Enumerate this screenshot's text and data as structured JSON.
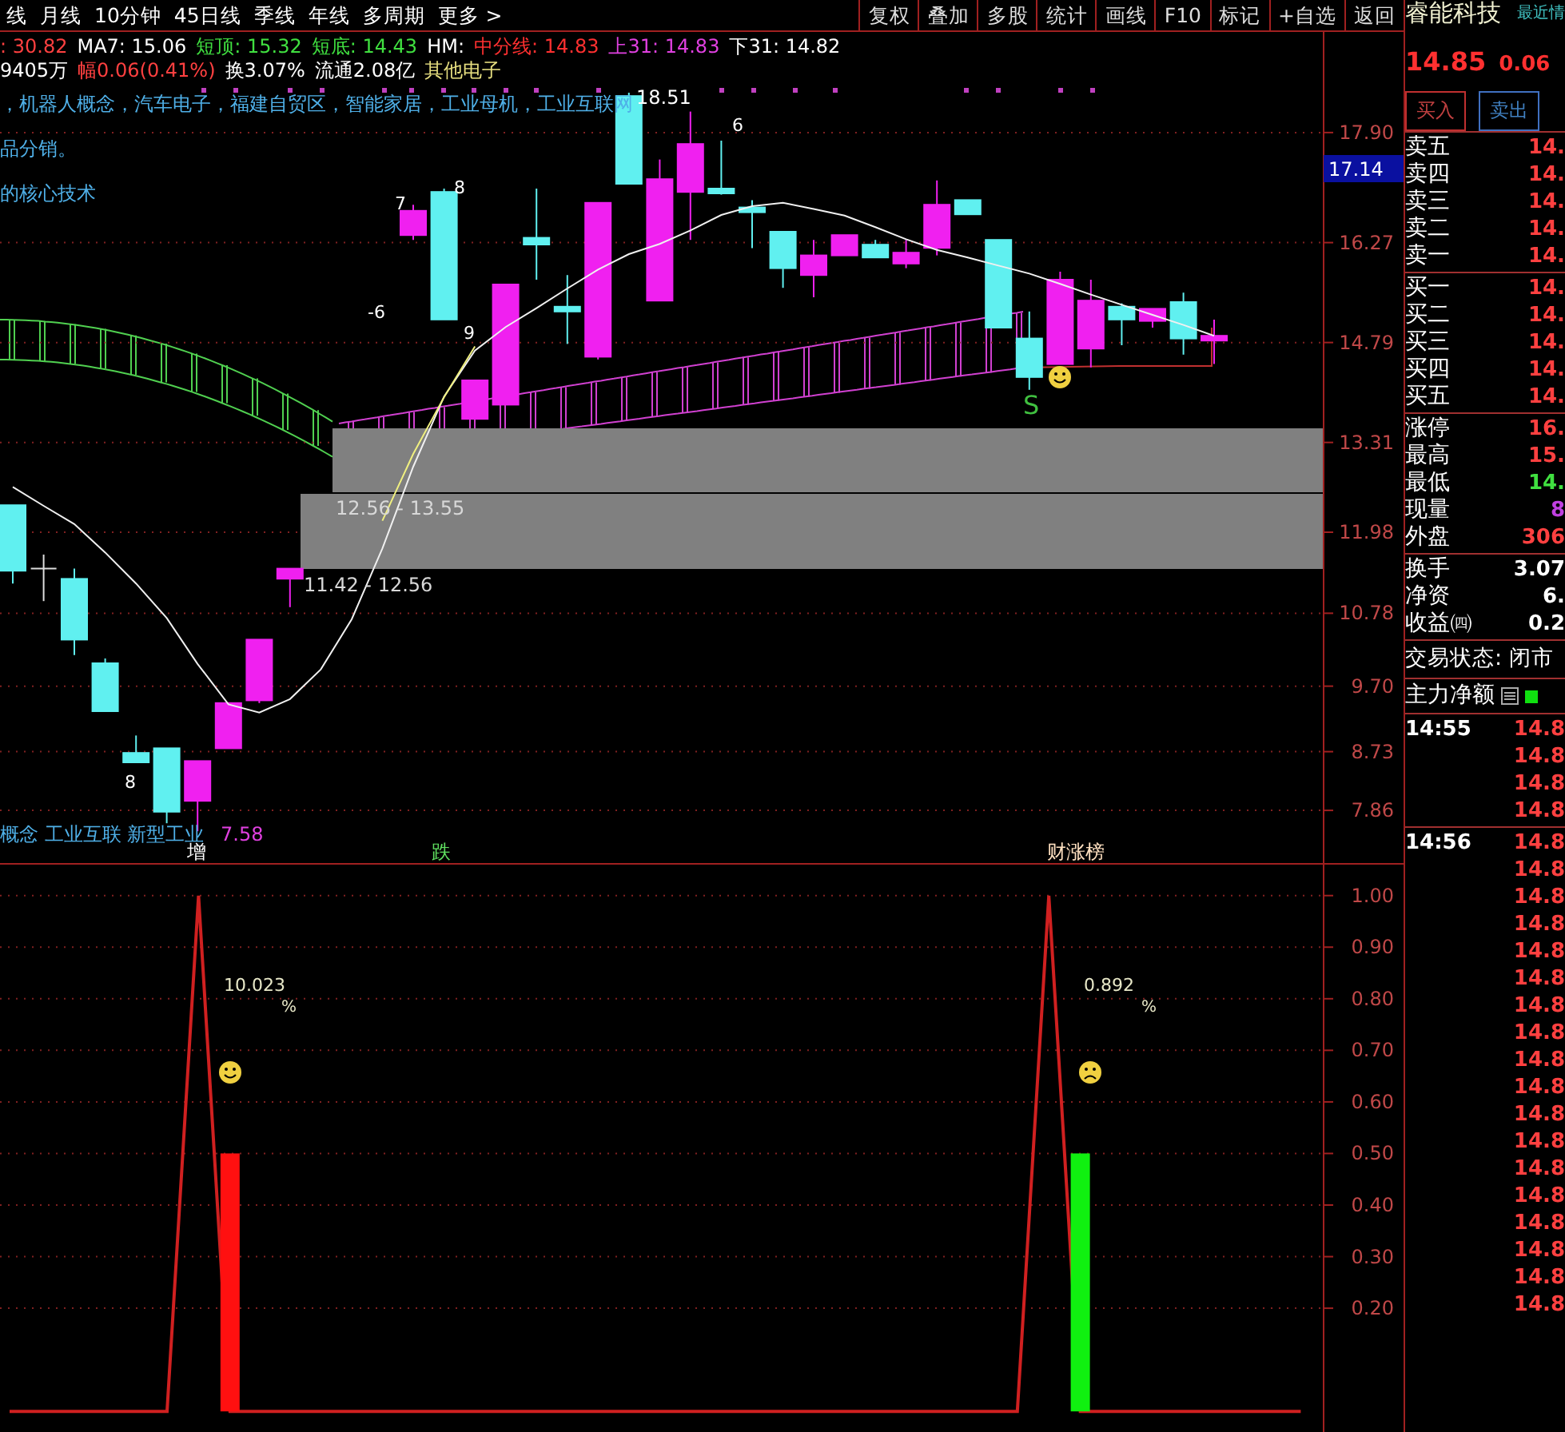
{
  "toolbar": {
    "periods": [
      "线",
      "月线",
      "10分钟",
      "45日线",
      "季线",
      "年线",
      "多周期",
      "更多 >"
    ],
    "actions": [
      "复权",
      "叠加",
      "多股",
      "统计",
      "画线",
      "F10",
      "标记",
      "+自选",
      "返回"
    ]
  },
  "readout_lines": [
    {
      "segments": [
        {
          "text": ": 30.82",
          "color": "#ff4040"
        },
        {
          "text": "MA7: 15.06",
          "color": "#ffffff"
        },
        {
          "text": "短顶: 15.32",
          "color": "#40e040"
        },
        {
          "text": "短底: 14.43",
          "color": "#40e040"
        },
        {
          "text": "HM:",
          "color": "#ffffff"
        },
        {
          "text": "中分线: 14.83",
          "color": "#ff3030"
        },
        {
          "text": "上31: 14.83",
          "color": "#e040e0"
        },
        {
          "text": "下31: 14.82",
          "color": "#ffffff"
        }
      ]
    },
    {
      "segments": [
        {
          "text": "9405万",
          "color": "#ffffff"
        },
        {
          "text": "幅0.06(0.41%)",
          "color": "#ff4040"
        },
        {
          "text": "换3.07%",
          "color": "#ffffff"
        },
        {
          "text": "流通2.08亿",
          "color": "#ffffff"
        },
        {
          "text": "其他电子",
          "color": "#e8e080"
        }
      ]
    }
  ],
  "concept_lines": [
    "，机器人概念，汽车电子，福建自贸区，智能家居，工业母机，工业互联网",
    "品分销。",
    "的核心技术"
  ],
  "chart_labels": [
    {
      "text": "18.51",
      "color": "#ffffff"
    },
    {
      "text": "6",
      "color": "#ffffff"
    },
    {
      "text": "7",
      "color": "#ffffff"
    },
    {
      "text": "8",
      "color": "#ffffff"
    },
    {
      "text": "-6",
      "color": "#ffffff"
    },
    {
      "text": "9",
      "color": "#ffffff"
    },
    {
      "text": "12.56 - 13.55",
      "color": "#d8d8d8"
    },
    {
      "text": "11.42 - 12.56",
      "color": "#d8d8d8"
    },
    {
      "text": "S",
      "color": "#40c040"
    },
    {
      "text": "8",
      "color": "#ffffff"
    }
  ],
  "bottom_tags": [
    {
      "text": "概念 工业互联 新型工业",
      "color": "#4fb0e8"
    },
    {
      "text": "7.58",
      "color": "#e040e0"
    },
    {
      "text": "增",
      "color": "#ffffff"
    },
    {
      "text": "跌",
      "color": "#60e060"
    },
    {
      "text": "财涨榜",
      "color": "#ffe0c0"
    }
  ],
  "main_chart": {
    "chart_data": {
      "type": "candlestick",
      "grid": true,
      "ylim": [
        7.08,
        19.39
      ],
      "ohlc": [
        [
          12.38,
          12.38,
          11.22,
          11.41
        ],
        [
          11.44,
          11.65,
          10.96,
          11.44
        ],
        [
          11.29,
          11.44,
          10.16,
          10.39
        ],
        [
          10.04,
          10.11,
          9.33,
          9.33
        ],
        [
          8.71,
          8.97,
          8.57,
          8.57
        ],
        [
          8.78,
          8.78,
          7.67,
          7.84
        ],
        [
          8.0,
          8.59,
          7.55,
          8.59
        ],
        [
          8.78,
          9.45,
          8.78,
          9.45
        ],
        [
          9.49,
          10.39,
          9.45,
          10.39
        ],
        [
          11.29,
          11.44,
          10.87,
          11.44
        ],
        null,
        null,
        null,
        [
          16.38,
          16.83,
          16.31,
          16.74
        ],
        [
          17.02,
          17.07,
          15.13,
          15.13
        ],
        [
          13.66,
          14.23,
          13.66,
          14.23
        ],
        [
          13.87,
          15.65,
          13.87,
          15.65
        ],
        [
          16.34,
          17.07,
          15.72,
          16.24
        ],
        [
          15.32,
          15.79,
          14.77,
          15.25
        ],
        [
          14.58,
          16.86,
          14.54,
          16.86
        ],
        [
          18.44,
          18.49,
          17.14,
          17.14
        ],
        [
          15.41,
          17.5,
          15.41,
          17.21
        ],
        [
          17.02,
          18.21,
          16.31,
          17.73
        ],
        [
          17.07,
          17.78,
          16.98,
          17.0
        ],
        [
          16.79,
          16.9,
          16.19,
          16.72
        ],
        [
          16.43,
          16.43,
          15.6,
          15.89
        ],
        [
          15.79,
          16.31,
          15.46,
          16.08
        ],
        [
          16.08,
          16.38,
          16.08,
          16.38
        ],
        [
          16.24,
          16.31,
          16.05,
          16.05
        ],
        [
          15.96,
          16.31,
          15.89,
          16.12
        ],
        [
          16.19,
          17.19,
          16.08,
          16.83
        ],
        [
          16.9,
          16.9,
          16.69,
          16.69
        ],
        [
          16.31,
          16.31,
          15.01,
          15.01
        ],
        [
          14.85,
          15.25,
          14.09,
          14.28
        ],
        [
          14.47,
          15.84,
          14.47,
          15.72
        ],
        [
          14.7,
          15.72,
          14.42,
          15.41
        ],
        [
          15.32,
          15.37,
          14.75,
          15.13
        ],
        [
          15.11,
          15.29,
          15.01,
          15.29
        ],
        [
          15.39,
          15.53,
          14.61,
          14.85
        ],
        [
          14.82,
          15.13,
          14.47,
          14.89
        ]
      ],
      "yticks": [
        {
          "value": 17.9,
          "label": "17.90"
        },
        {
          "value": 16.27,
          "label": "16.27"
        },
        {
          "value": 14.79,
          "label": "14.79"
        },
        {
          "value": 13.31,
          "label": "13.31"
        },
        {
          "value": 11.98,
          "label": "11.98"
        },
        {
          "value": 10.78,
          "label": "10.78"
        },
        {
          "value": 9.7,
          "label": "9.70"
        },
        {
          "value": 8.73,
          "label": "8.73"
        },
        {
          "value": 7.86,
          "label": "7.86"
        }
      ],
      "series": [
        {
          "type": "line",
          "color": "#f0f0f0",
          "values": [
            12.65,
            12.37,
            12.1,
            11.68,
            11.22,
            10.71,
            10.03,
            9.43,
            9.31,
            9.51,
            9.95,
            10.69,
            11.74,
            12.95,
            13.99,
            14.67,
            15.02,
            15.3,
            15.59,
            15.87,
            16.1,
            16.25,
            16.45,
            16.68,
            16.81,
            16.86,
            16.77,
            16.67,
            16.5,
            16.32,
            16.16,
            16.05,
            15.93,
            15.81,
            15.66,
            15.5,
            15.35,
            15.2,
            15.05,
            14.89
          ]
        },
        {
          "type": "line",
          "color": "#f0f080",
          "values": [
            null,
            null,
            null,
            null,
            null,
            null,
            null,
            null,
            null,
            null,
            null,
            null,
            12.15,
            13.14,
            13.98,
            14.73,
            null,
            null,
            null,
            null,
            null,
            null,
            null,
            null,
            null,
            null,
            null,
            null,
            null,
            null,
            null,
            null,
            null,
            null,
            null,
            null,
            null,
            null,
            null,
            null
          ]
        }
      ]
    },
    "current": "17.14"
  },
  "indicator": {
    "chart_data": {
      "type": "line",
      "grid": true,
      "ylim": [
        -0.04,
        1.06
      ],
      "yticks": [
        {
          "value": 1,
          "label": "1.00"
        },
        {
          "value": 0.9,
          "label": "0.90"
        },
        {
          "value": 0.8,
          "label": "0.80"
        },
        {
          "value": 0.7,
          "label": "0.70"
        },
        {
          "value": 0.6,
          "label": "0.60"
        },
        {
          "value": 0.5,
          "label": "0.50"
        },
        {
          "value": 0.4,
          "label": "0.40"
        },
        {
          "value": 0.3,
          "label": "0.30"
        },
        {
          "value": 0.2,
          "label": "0.20"
        }
      ],
      "series": [
        {
          "color": "#d02020",
          "values": [
            0,
            0,
            0,
            0,
            0,
            0,
            1,
            0,
            0,
            0,
            0,
            0,
            0,
            0,
            0,
            0,
            0,
            0,
            0,
            0,
            0,
            0,
            0,
            0,
            0,
            0,
            0,
            0,
            0,
            0,
            0,
            0,
            0,
            1,
            0,
            0,
            0,
            0,
            0,
            0,
            0,
            0
          ]
        },
        {
          "type": "bar",
          "color": "#ff1010",
          "values": [
            null,
            null,
            null,
            null,
            null,
            null,
            null,
            0.5,
            null,
            null,
            null,
            null,
            null,
            null,
            null,
            null,
            null,
            null,
            null,
            null,
            null,
            null,
            null,
            null,
            null,
            null,
            null,
            null,
            null,
            null,
            null,
            null,
            null,
            null,
            null,
            null,
            null,
            null,
            null,
            null,
            null,
            null
          ]
        },
        {
          "type": "bar",
          "color": "#10f010",
          "values": [
            null,
            null,
            null,
            null,
            null,
            null,
            null,
            null,
            null,
            null,
            null,
            null,
            null,
            null,
            null,
            null,
            null,
            null,
            null,
            null,
            null,
            null,
            null,
            null,
            null,
            null,
            null,
            null,
            null,
            null,
            null,
            null,
            null,
            null,
            0.5,
            null,
            null,
            null,
            null,
            null,
            null,
            null
          ]
        }
      ]
    },
    "labels": [
      {
        "value": "10.023",
        "unit": "%",
        "kind": "happy"
      },
      {
        "value": "0.892",
        "unit": "%",
        "kind": "sad"
      }
    ]
  },
  "quote": {
    "name": "睿能科技",
    "tab": "最近情",
    "price": "14.85",
    "change": "0.06",
    "buy": "买入",
    "sell": "卖出"
  },
  "book": [
    [
      {
        "label": "卖五",
        "value": "14.",
        "color": "#ff4040"
      },
      {
        "label": "卖四",
        "value": "14.",
        "color": "#ff4040"
      },
      {
        "label": "卖三",
        "value": "14.",
        "color": "#ff4040"
      },
      {
        "label": "卖二",
        "value": "14.",
        "color": "#ff4040"
      },
      {
        "label": "卖一",
        "value": "14.",
        "color": "#ff4040"
      }
    ],
    [
      {
        "label": "买一",
        "value": "14.",
        "color": "#ff4040"
      },
      {
        "label": "买二",
        "value": "14.",
        "color": "#ff4040"
      },
      {
        "label": "买三",
        "value": "14.",
        "color": "#ff4040"
      },
      {
        "label": "买四",
        "value": "14.",
        "color": "#ff4040"
      },
      {
        "label": "买五",
        "value": "14.",
        "color": "#ff4040"
      }
    ],
    [
      {
        "label": "涨停",
        "value": "16.",
        "color": "#ff4040"
      },
      {
        "label": "最高",
        "value": "15.",
        "color": "#ff4040"
      },
      {
        "label": "最低",
        "value": "14.",
        "color": "#40e040"
      },
      {
        "label": "现量",
        "value": "8",
        "color": "#c040e0"
      },
      {
        "label": "外盘",
        "value": "306",
        "color": "#ff4040"
      }
    ],
    [
      {
        "label": "换手",
        "value": "3.07",
        "color": "#ffffff"
      },
      {
        "label": "净资",
        "value": "6.",
        "color": "#ffffff"
      },
      {
        "label": "收益㈣",
        "value": "0.2",
        "color": "#ffffff"
      }
    ]
  ],
  "status": "交易状态: 闭市",
  "main_force": "主力净额",
  "ticks": [
    {
      "time": "14:55",
      "prices": [
        "14.8",
        "14.8",
        "14.8",
        "14.8"
      ]
    },
    {
      "time": "14:56",
      "prices": [
        "14.8",
        "14.8",
        "14.8",
        "14.8",
        "14.8",
        "14.8",
        "14.8",
        "14.8",
        "14.8",
        "14.8",
        "14.8",
        "14.8",
        "14.8",
        "14.8",
        "14.8",
        "14.8",
        "14.8",
        "14.8"
      ]
    }
  ]
}
